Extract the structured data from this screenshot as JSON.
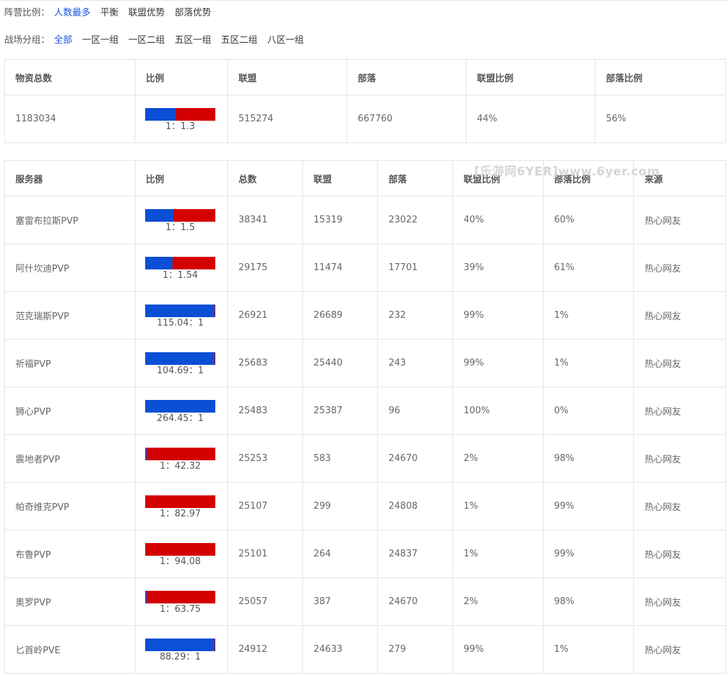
{
  "filters": {
    "ratio": {
      "label": "阵营比例：",
      "options": [
        {
          "label": "人数最多",
          "active": true
        },
        {
          "label": "平衡",
          "active": false
        },
        {
          "label": "联盟优势",
          "active": false
        },
        {
          "label": "部落优势",
          "active": false
        }
      ]
    },
    "group": {
      "label": "战场分组：",
      "options": [
        {
          "label": "全部",
          "active": true
        },
        {
          "label": "一区一组",
          "active": false
        },
        {
          "label": "一区二组",
          "active": false
        },
        {
          "label": "五区一组",
          "active": false
        },
        {
          "label": "五区二组",
          "active": false
        },
        {
          "label": "八区一组",
          "active": false
        }
      ]
    }
  },
  "colors": {
    "alliance": "#0b4fd6",
    "horde": "#d40000",
    "active": "#1a56db"
  },
  "summary": {
    "headers": [
      "物资总数",
      "比例",
      "联盟",
      "部落",
      "联盟比例",
      "部落比例"
    ],
    "row": {
      "total": "1183034",
      "alliance_share": 0.44,
      "ratio_text": "1：1.3",
      "alliance": "515274",
      "horde": "667760",
      "alliance_pct": "44%",
      "horde_pct": "56%"
    }
  },
  "watermark": "[乐游网6YER]www.6yer.com",
  "servers": {
    "headers": [
      "服务器",
      "比例",
      "总数",
      "联盟",
      "部落",
      "联盟比例",
      "部落比例",
      "来源"
    ],
    "rows": [
      {
        "name": "塞雷布拉斯PVP",
        "alliance_share": 0.4,
        "ratio_text": "1：1.5",
        "total": "38341",
        "alliance": "15319",
        "horde": "23022",
        "alliance_pct": "40%",
        "horde_pct": "60%",
        "source": "热心网友"
      },
      {
        "name": "阿什坎迪PVP",
        "alliance_share": 0.39,
        "ratio_text": "1：1.54",
        "total": "29175",
        "alliance": "11474",
        "horde": "17701",
        "alliance_pct": "39%",
        "horde_pct": "61%",
        "source": "热心网友"
      },
      {
        "name": "范克瑞斯PVP",
        "alliance_share": 0.99,
        "ratio_text": "115.04：1",
        "total": "26921",
        "alliance": "26689",
        "horde": "232",
        "alliance_pct": "99%",
        "horde_pct": "1%",
        "source": "热心网友"
      },
      {
        "name": "祈福PVP",
        "alliance_share": 0.99,
        "ratio_text": "104.69：1",
        "total": "25683",
        "alliance": "25440",
        "horde": "243",
        "alliance_pct": "99%",
        "horde_pct": "1%",
        "source": "热心网友"
      },
      {
        "name": "狮心PVP",
        "alliance_share": 1.0,
        "ratio_text": "264.45：1",
        "total": "25483",
        "alliance": "25387",
        "horde": "96",
        "alliance_pct": "100%",
        "horde_pct": "0%",
        "source": "热心网友"
      },
      {
        "name": "震地者PVP",
        "alliance_share": 0.02,
        "ratio_text": "1：42.32",
        "total": "25253",
        "alliance": "583",
        "horde": "24670",
        "alliance_pct": "2%",
        "horde_pct": "98%",
        "source": "热心网友"
      },
      {
        "name": "帕奇维克PVP",
        "alliance_share": 0.01,
        "ratio_text": "1：82.97",
        "total": "25107",
        "alliance": "299",
        "horde": "24808",
        "alliance_pct": "1%",
        "horde_pct": "99%",
        "source": "热心网友"
      },
      {
        "name": "布鲁PVP",
        "alliance_share": 0.01,
        "ratio_text": "1：94.08",
        "total": "25101",
        "alliance": "264",
        "horde": "24837",
        "alliance_pct": "1%",
        "horde_pct": "99%",
        "source": "热心网友"
      },
      {
        "name": "奥罗PVP",
        "alliance_share": 0.02,
        "ratio_text": "1：63.75",
        "total": "25057",
        "alliance": "387",
        "horde": "24670",
        "alliance_pct": "2%",
        "horde_pct": "98%",
        "source": "热心网友"
      },
      {
        "name": "匕首岭PVE",
        "alliance_share": 0.99,
        "ratio_text": "88.29：1",
        "total": "24912",
        "alliance": "24633",
        "horde": "279",
        "alliance_pct": "99%",
        "horde_pct": "1%",
        "source": "热心网友"
      }
    ]
  }
}
